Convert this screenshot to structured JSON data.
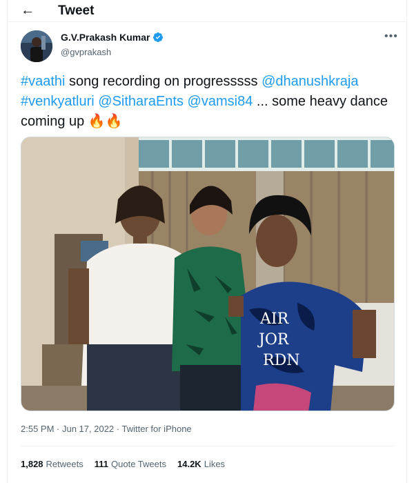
{
  "header": {
    "title": "Tweet",
    "back_icon": "arrow-left-icon"
  },
  "author": {
    "name": "G.V.Prakash Kumar",
    "handle": "@gvprakash",
    "verified_icon": "verified-badge-icon"
  },
  "more_icon": "more-options-icon",
  "tweet": {
    "parts": [
      {
        "text": "#vaathi",
        "link": true
      },
      {
        "text": " song recording on progresssss ",
        "link": false
      },
      {
        "text": "@dhanushkraja",
        "link": true
      },
      {
        "text": " ",
        "link": false
      },
      {
        "text": "#venkyatluri",
        "link": true
      },
      {
        "text": " ",
        "link": false
      },
      {
        "text": "@SitharaEnts",
        "link": true
      },
      {
        "text": " ",
        "link": false
      },
      {
        "text": "@vamsi84",
        "link": true
      },
      {
        "text": " ... some heavy dance coming up ",
        "link": false
      },
      {
        "text": "🔥🔥",
        "link": false
      }
    ]
  },
  "media": {
    "description_icon": "photo"
  },
  "meta": {
    "time": "2:55 PM",
    "separator": " · ",
    "date": "Jun 17, 2022",
    "source": "Twitter for iPhone"
  },
  "stats": {
    "retweets_count": "1,828",
    "retweets_label": "Retweets",
    "quotes_count": "111",
    "quotes_label": "Quote Tweets",
    "likes_count": "14.2K",
    "likes_label": "Likes"
  },
  "colors": {
    "link": "#1d9bf0",
    "secondary": "#536471",
    "text": "#0f1419"
  }
}
